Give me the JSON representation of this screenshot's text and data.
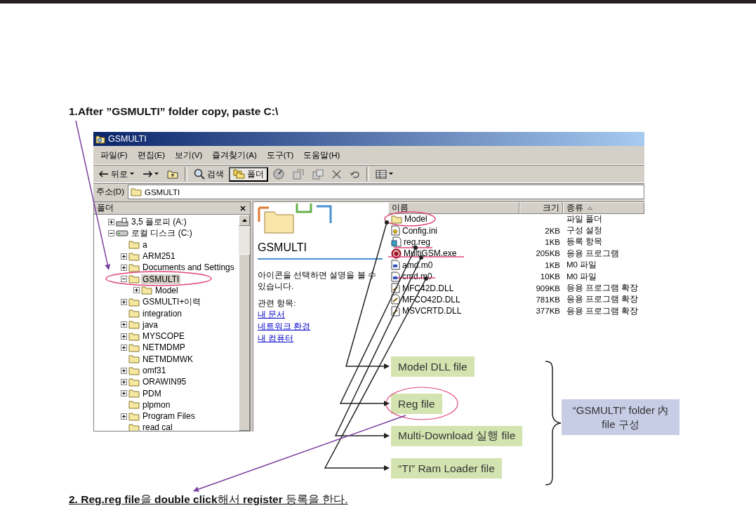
{
  "instruction_1": "1.After ”GSMULTI” folder copy, paste C:\\",
  "window": {
    "title": "GSMULTI",
    "menu": [
      "파일(F)",
      "편집(E)",
      "보기(V)",
      "즐겨찾기(A)",
      "도구(T)",
      "도움말(H)"
    ],
    "toolbar": [
      {
        "kind": "back",
        "label": "뒤로",
        "selected": false
      },
      {
        "kind": "forward",
        "selected": false
      },
      {
        "kind": "up",
        "selected": false
      },
      {
        "kind": "search",
        "label": "검색",
        "selected": false
      },
      {
        "kind": "folders",
        "label": "폴더",
        "selected": true
      },
      {
        "kind": "history",
        "selected": false
      },
      {
        "kind": "move",
        "selected": false
      },
      {
        "kind": "copy",
        "selected": false
      },
      {
        "kind": "delete",
        "selected": false
      },
      {
        "kind": "undo",
        "selected": false
      },
      {
        "kind": "views",
        "selected": false
      }
    ],
    "address": {
      "label": "주소(D)",
      "value": "GSMULTI"
    }
  },
  "folder_pane": {
    "title": "폴더",
    "items": [
      {
        "label": "3,5 플로피 (A:)",
        "kind": "floppy",
        "expanded": false,
        "selected": false
      },
      {
        "label": "로컬 디스크 (C:)",
        "kind": "disk",
        "expanded": true,
        "selected": false,
        "children": [
          {
            "label": "a",
            "kind": "folder",
            "selected": false
          },
          {
            "label": "ARM251",
            "kind": "folder",
            "expanded": false,
            "selected": false
          },
          {
            "label": "Documents and Settings",
            "kind": "folder",
            "expanded": false,
            "selected": false
          },
          {
            "label": "GSMULTI",
            "kind": "folder",
            "expanded": true,
            "selected": true,
            "children": [
              {
                "label": "Model",
                "kind": "folder",
                "expanded": false,
                "selected": false
              }
            ]
          },
          {
            "label": "GSMULTI+이력",
            "kind": "folder",
            "expanded": false,
            "selected": false
          },
          {
            "label": "integration",
            "kind": "folder",
            "selected": false
          },
          {
            "label": "java",
            "kind": "folder",
            "expanded": false,
            "selected": false
          },
          {
            "label": "MYSCOPE",
            "kind": "folder",
            "expanded": false,
            "selected": false
          },
          {
            "label": "NETMDMP",
            "kind": "folder",
            "expanded": false,
            "selected": false
          },
          {
            "label": "NETMDMWK",
            "kind": "folder",
            "selected": false
          },
          {
            "label": "omf31",
            "kind": "folder",
            "expanded": false,
            "selected": false
          },
          {
            "label": "ORAWIN95",
            "kind": "folder",
            "expanded": false,
            "selected": false
          },
          {
            "label": "PDM",
            "kind": "folder",
            "expanded": false,
            "selected": false
          },
          {
            "label": "plpmon",
            "kind": "folder",
            "selected": false
          },
          {
            "label": "Program Files",
            "kind": "folder",
            "expanded": false,
            "selected": false
          },
          {
            "label": "read cal",
            "kind": "folder",
            "selected": false
          }
        ]
      }
    ]
  },
  "info_pane": {
    "title": "GSMULTI",
    "description": "아이콘을 선택하면 설명을 볼 수 있습니다.",
    "related_title": "관련 항목:",
    "links": [
      "내 문서",
      "네트워크 환경",
      "내 컴퓨터"
    ]
  },
  "file_list": {
    "columns": [
      {
        "label": "이름",
        "sorted": false
      },
      {
        "label": "크기",
        "sorted": false
      },
      {
        "label": "종류",
        "sorted": true
      }
    ],
    "rows": [
      {
        "name": "Model",
        "kind": "folder",
        "size": "",
        "type": "파일 폴더"
      },
      {
        "name": "Config.ini",
        "kind": "config",
        "size": "2KB",
        "type": "구성 설정"
      },
      {
        "name": "reg.reg",
        "kind": "reg",
        "size": "1KB",
        "type": "등록 항목"
      },
      {
        "name": "MultiGSM.exe",
        "kind": "exe",
        "size": "205KB",
        "type": "응용 프로그램"
      },
      {
        "name": "amd.m0",
        "kind": "m0",
        "size": "1KB",
        "type": "M0 파일"
      },
      {
        "name": "cmd.m0",
        "kind": "m0",
        "size": "10KB",
        "type": "M0 파일"
      },
      {
        "name": "MFC42D.DLL",
        "kind": "dll",
        "size": "909KB",
        "type": "응용 프로그램 확장"
      },
      {
        "name": "MFCO42D.DLL",
        "kind": "dll",
        "size": "781KB",
        "type": "응용 프로그램 확장"
      },
      {
        "name": "MSVCRTD.DLL",
        "kind": "dll",
        "size": "377KB",
        "type": "응용 프로그램 확장"
      }
    ]
  },
  "annotations": {
    "labels": [
      "Model DLL file",
      "Reg file",
      "Multi-Download 실행 file",
      "“TI” Ram Loader file"
    ],
    "summary": "“GSMULTI” folder 內 file 구성"
  },
  "instruction_2": "**2. Reg.reg file**을 **double click**해서 **register** 등록을 한다."
}
